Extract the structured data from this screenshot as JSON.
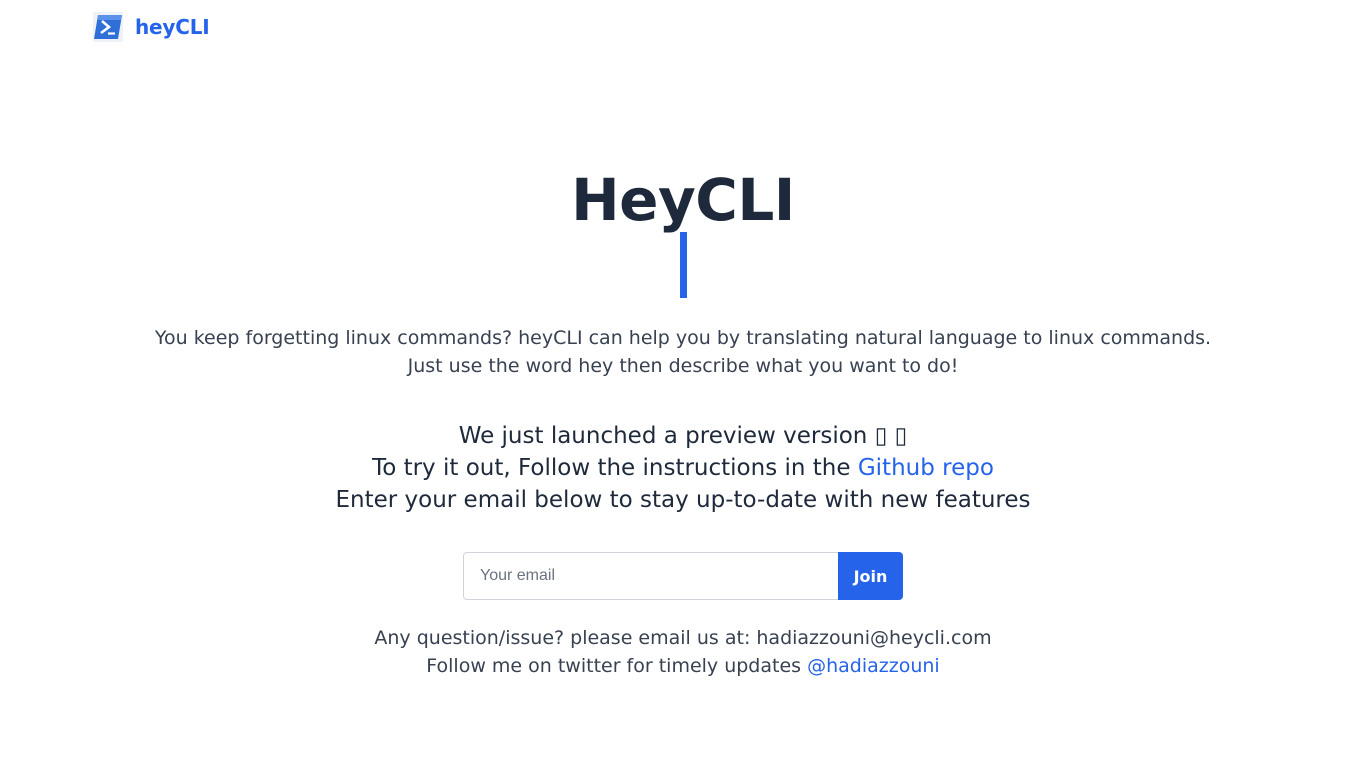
{
  "nav": {
    "brand": "heyCLI"
  },
  "hero": {
    "title": "HeyCLI",
    "description_line1": "You keep forgetting linux commands? heyCLI can help you by translating natural language to linux commands.",
    "description_line2": "Just use the word hey then describe what you want to do!"
  },
  "announcement": {
    "line1": "We just launched a preview version",
    "line1_emoji": "▯ ▯",
    "line2_prefix": "To try it out, Follow the instructions in the",
    "line2_link": "Github repo",
    "line3": "Enter your email below to stay up-to-date with new features"
  },
  "signup": {
    "email_placeholder": "Your email",
    "email_value": "",
    "join_label": "Join"
  },
  "footer": {
    "contact": "Any question/issue? please email us at: hadiazzouni@heycli.com",
    "twitter_prefix": "Follow me on twitter for timely updates",
    "twitter_handle": "@hadiazzouni"
  },
  "colors": {
    "accent": "#2563eb",
    "heading": "#1e293b",
    "body_text": "#374151"
  },
  "icons": {
    "logo": "terminal-prompt-icon"
  }
}
